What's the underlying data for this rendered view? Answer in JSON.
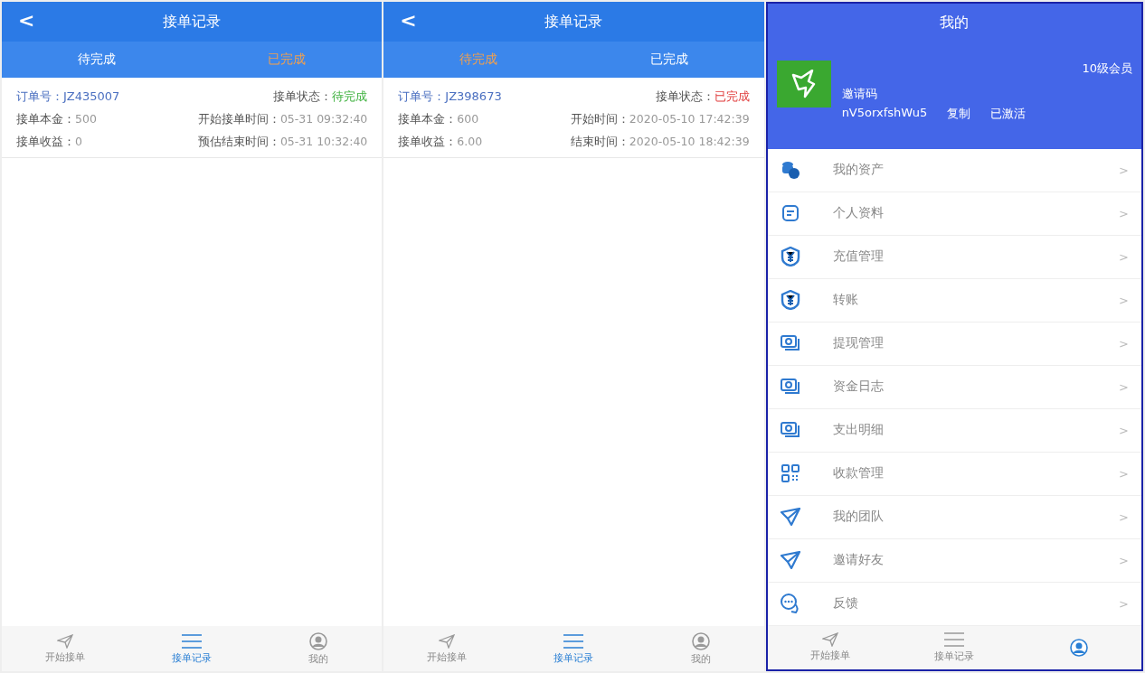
{
  "screens": [
    {
      "kind": "orders",
      "title": "接单记录",
      "back": "<",
      "tabs": [
        {
          "label": "待完成",
          "selected": true
        },
        {
          "label": "已完成",
          "selected": false
        }
      ],
      "orders": [
        {
          "order_label": "订单号：",
          "order_no": "JZ435007",
          "status_label": "接单状态：",
          "status": "待完成",
          "done": false,
          "fields": [
            [
              "接单本金：",
              "500",
              "开始接单时间：",
              "05-31 09:32:40"
            ],
            [
              "接单收益：",
              "0",
              "预估结束时间：",
              "05-31 10:32:40"
            ]
          ]
        }
      ],
      "nav": [
        {
          "label": "开始接单",
          "selected": false
        },
        {
          "label": "接单记录",
          "selected": true
        },
        {
          "label": "我的",
          "selected": false
        }
      ]
    },
    {
      "kind": "orders",
      "title": "接单记录",
      "back": "<",
      "tabs": [
        {
          "label": "待完成",
          "selected": false
        },
        {
          "label": "已完成",
          "selected": true
        }
      ],
      "orders": [
        {
          "order_label": "订单号：",
          "order_no": "JZ398673",
          "status_label": "接单状态：",
          "status": "已完成",
          "done": true,
          "fields": [
            [
              "接单本金：",
              "600",
              "开始时间：",
              "2020-05-10 17:42:39"
            ],
            [
              "接单收益：",
              "6.00",
              "结束时间：",
              "2020-05-10 18:42:39"
            ]
          ]
        }
      ],
      "nav": [
        {
          "label": "开始接单",
          "selected": false
        },
        {
          "label": "接单记录",
          "selected": true
        },
        {
          "label": "我的",
          "selected": false
        }
      ]
    },
    {
      "kind": "profile",
      "title": "我的",
      "level": "10级会员",
      "invite_label": "邀请码",
      "invite_code": "nV5orxfshWu5",
      "copy": "复制",
      "activated": "已激活",
      "menu": [
        {
          "label": "我的资产",
          "arrow": ">"
        },
        {
          "label": "个人资料",
          "arrow": ">"
        },
        {
          "label": "充值管理",
          "arrow": ">"
        },
        {
          "label": "转账",
          "arrow": ">"
        },
        {
          "label": "提现管理",
          "arrow": ">"
        },
        {
          "label": "资金日志",
          "arrow": ">"
        },
        {
          "label": "支出明细",
          "arrow": ">"
        },
        {
          "label": "收款管理",
          "arrow": ">"
        },
        {
          "label": "我的团队",
          "arrow": ">"
        },
        {
          "label": "邀请好友",
          "arrow": ">"
        },
        {
          "label": "反馈",
          "arrow": ">"
        }
      ],
      "nav": [
        {
          "label": "开始接单",
          "selected": false
        },
        {
          "label": "接单记录",
          "selected": false
        },
        {
          "selected": true
        }
      ]
    }
  ]
}
